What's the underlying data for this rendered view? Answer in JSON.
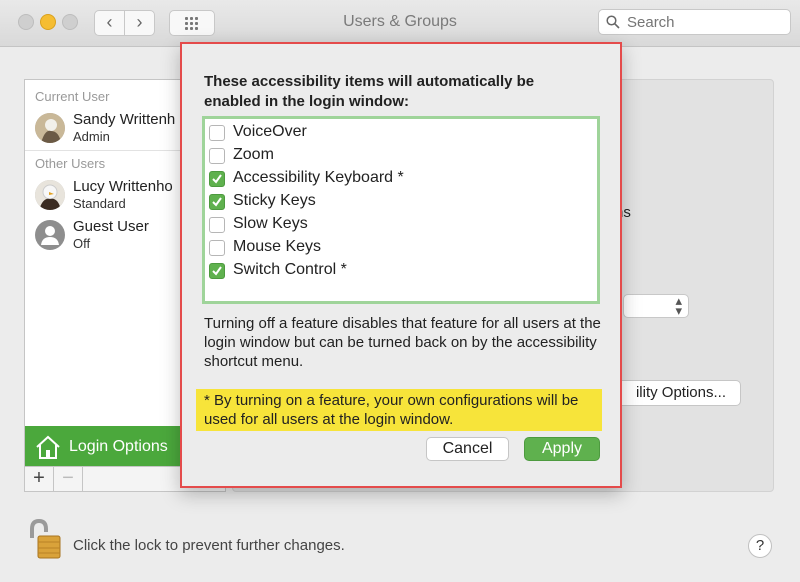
{
  "window": {
    "title": "Users & Groups",
    "back_glyph": "‹",
    "forward_glyph": "›",
    "search_placeholder": "Search"
  },
  "sidebar": {
    "current_user_header": "Current User",
    "other_users_header": "Other Users",
    "current_user": {
      "name": "Sandy Writtenh",
      "role": "Admin"
    },
    "other_users": [
      {
        "name": "Lucy Writtenho",
        "role": "Standard"
      },
      {
        "name": "Guest User",
        "role": "Off"
      }
    ],
    "login_options_label": "Login Options",
    "add_glyph": "+",
    "remove_glyph": "−"
  },
  "background_pane": {
    "text_ns": "ns",
    "options_button_label": "ility Options..."
  },
  "lock": {
    "text": "Click the lock to prevent further changes."
  },
  "help_glyph": "?",
  "sheet": {
    "heading": "These accessibility items will automatically be enabled in the login window:",
    "items": [
      {
        "label": "VoiceOver",
        "checked": false
      },
      {
        "label": "Zoom",
        "checked": false
      },
      {
        "label": "Accessibility Keyboard *",
        "checked": true
      },
      {
        "label": "Sticky Keys",
        "checked": true
      },
      {
        "label": "Slow Keys",
        "checked": false
      },
      {
        "label": "Mouse Keys",
        "checked": false
      },
      {
        "label": "Switch Control *",
        "checked": true
      }
    ],
    "description": "Turning off a feature disables that feature for all users at the login window but can be turned back on by the accessibility shortcut menu.",
    "note": "* By turning on a feature, your own configurations will be used for all users at the login window.",
    "cancel_label": "Cancel",
    "apply_label": "Apply"
  },
  "colors": {
    "accent_green": "#5fb14e",
    "sheet_outline": "#e44b4b",
    "note_highlight": "#f7e43a",
    "listbox_outline": "#9fd49a"
  }
}
